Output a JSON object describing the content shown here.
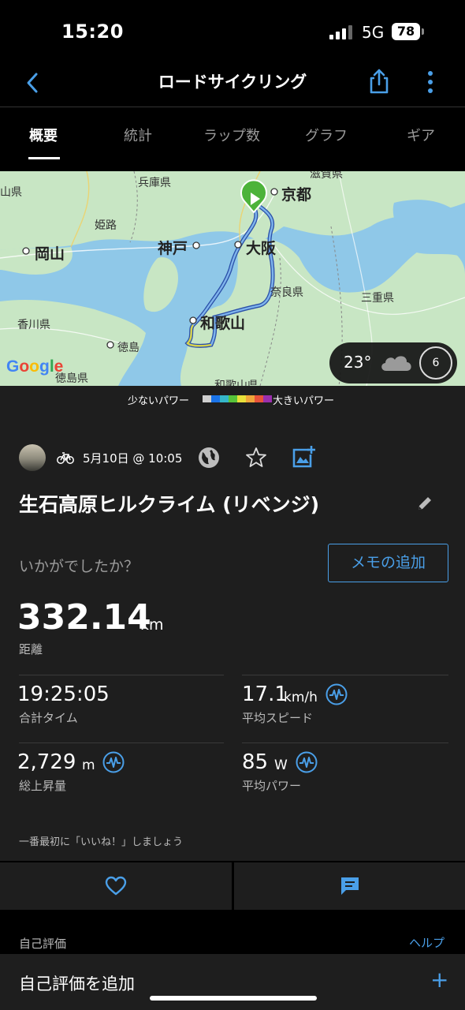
{
  "status_bar": {
    "time": "15:20",
    "network": "5G",
    "battery": "78"
  },
  "header": {
    "title": "ロードサイクリング",
    "back_icon": "chevron-left-icon",
    "share_icon": "share-icon",
    "more_icon": "more-vertical-icon"
  },
  "tabs": [
    {
      "label": "概要",
      "active": true
    },
    {
      "label": "統計",
      "active": false
    },
    {
      "label": "ラップ数",
      "active": false
    },
    {
      "label": "グラフ",
      "active": false
    },
    {
      "label": "ギア",
      "active": false
    }
  ],
  "map": {
    "labels": {
      "kyoto": "京都",
      "osaka": "大阪",
      "kobe": "神戸",
      "okayama": "岡山",
      "wakayama": "和歌山",
      "hyogo": "兵庫県",
      "himeji": "姫路",
      "nara": "奈良県",
      "mie": "三重県",
      "kagawa": "香川県",
      "tokushima": "徳島",
      "tokushima_pref": "徳島県",
      "wakayama_pref": "和歌山県",
      "yamaguchi_edge": "山県",
      "tsuruga_edge": "滋賀県"
    },
    "attribution": "Google",
    "weather": {
      "temperature": "23°",
      "icon": "cloud-icon",
      "wind": "6"
    },
    "colors": {
      "water": "#8fc8e8",
      "land": "#c8e6c4",
      "route": "#3a6bd6"
    }
  },
  "power_legend": {
    "low": "少ないパワー",
    "high": "大きいパワー",
    "colors": [
      "#cfcfcf",
      "#1a73e8",
      "#35b6c9",
      "#57c33a",
      "#e8e03a",
      "#f0a53a",
      "#e8533a",
      "#9b2fae"
    ]
  },
  "activity": {
    "date": "5月10日 @ 10:05",
    "title": "生石高原ヒルクライム (リベンジ)",
    "feedback_prompt": "いかがでしたか？",
    "add_memo": "メモの追加"
  },
  "distance": {
    "value": "332.14",
    "unit": "km",
    "label": "距離"
  },
  "stats": {
    "total_time": {
      "value": "19:25:05",
      "unit": "",
      "label": "合計タイム"
    },
    "avg_speed": {
      "value": "17.1",
      "unit": "km/h",
      "label": "平均スピード"
    },
    "elevation_gain": {
      "value": "2,729",
      "unit": "m",
      "label": "総上昇量"
    },
    "avg_power": {
      "value": "85",
      "unit": "W",
      "label": "平均パワー"
    }
  },
  "social": {
    "like_first": "一番最初に「いいね！」しましょう",
    "like_icon": "heart-icon",
    "comment_icon": "comment-icon"
  },
  "self_evaluation": {
    "section_label": "自己評価",
    "help": "ヘルプ",
    "add_label": "自己評価を追加",
    "add_icon": "+"
  },
  "accent_color": "#4a9fe8"
}
